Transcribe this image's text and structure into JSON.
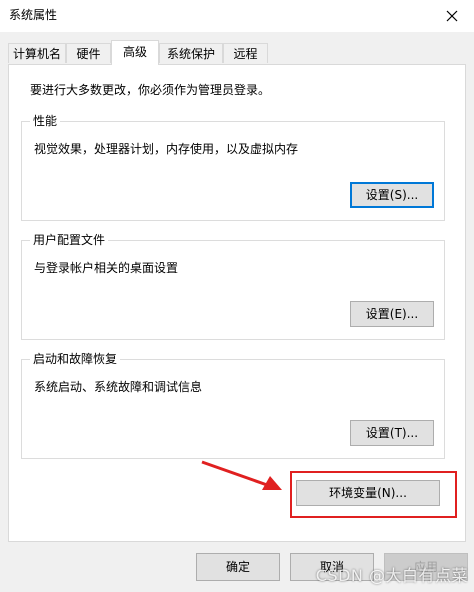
{
  "window": {
    "title": "系统属性"
  },
  "tabs": [
    {
      "label": "计算机名"
    },
    {
      "label": "硬件"
    },
    {
      "label": "高级"
    },
    {
      "label": "系统保护"
    },
    {
      "label": "远程"
    }
  ],
  "advanced": {
    "admin_note": "要进行大多数更改，你必须作为管理员登录。",
    "performance": {
      "title": "性能",
      "description": "视觉效果，处理器计划，内存使用，以及虚拟内存",
      "button": "设置(S)..."
    },
    "user_profiles": {
      "title": "用户配置文件",
      "description": "与登录帐户相关的桌面设置",
      "button": "设置(E)..."
    },
    "startup_recovery": {
      "title": "启动和故障恢复",
      "description": "系统启动、系统故障和调试信息",
      "button": "设置(T)..."
    },
    "env_button": "环境变量(N)..."
  },
  "footer": {
    "ok": "确定",
    "cancel": "取消",
    "apply": "应用"
  },
  "watermark": "CSDN @大白有点菜",
  "colors": {
    "highlight": "#e02020",
    "focus": "#0078d7"
  }
}
